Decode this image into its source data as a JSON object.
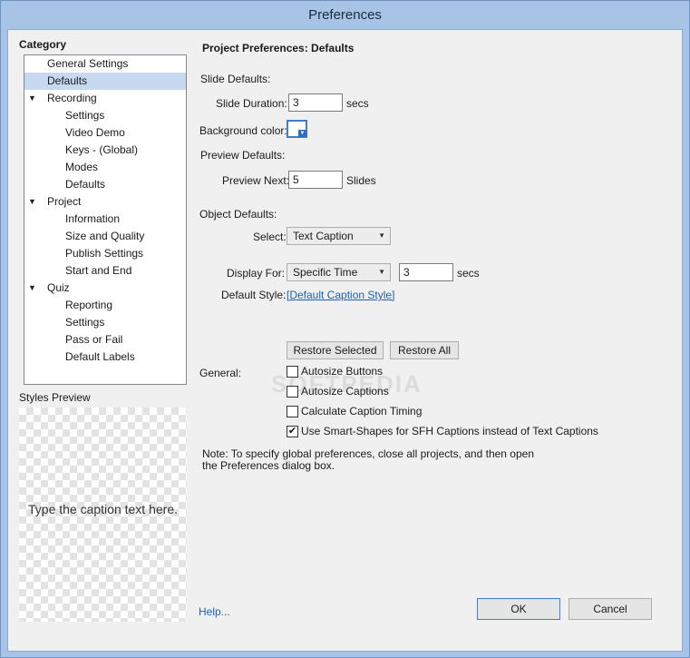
{
  "window": {
    "title": "Preferences"
  },
  "category": {
    "label": "Category",
    "items": [
      {
        "label": "General Settings",
        "level": 0,
        "expandable": false,
        "selected": false
      },
      {
        "label": "Defaults",
        "level": 0,
        "expandable": false,
        "selected": true
      },
      {
        "label": "Recording",
        "level": 0,
        "expandable": true,
        "selected": false
      },
      {
        "label": "Settings",
        "level": 1,
        "expandable": false,
        "selected": false
      },
      {
        "label": "Video Demo",
        "level": 1,
        "expandable": false,
        "selected": false
      },
      {
        "label": "Keys - (Global)",
        "level": 1,
        "expandable": false,
        "selected": false
      },
      {
        "label": "Modes",
        "level": 1,
        "expandable": false,
        "selected": false
      },
      {
        "label": "Defaults",
        "level": 1,
        "expandable": false,
        "selected": false
      },
      {
        "label": "Project",
        "level": 0,
        "expandable": true,
        "selected": false
      },
      {
        "label": "Information",
        "level": 1,
        "expandable": false,
        "selected": false
      },
      {
        "label": "Size and Quality",
        "level": 1,
        "expandable": false,
        "selected": false
      },
      {
        "label": "Publish Settings",
        "level": 1,
        "expandable": false,
        "selected": false
      },
      {
        "label": "Start and End",
        "level": 1,
        "expandable": false,
        "selected": false
      },
      {
        "label": "Quiz",
        "level": 0,
        "expandable": true,
        "selected": false
      },
      {
        "label": "Reporting",
        "level": 1,
        "expandable": false,
        "selected": false
      },
      {
        "label": "Settings",
        "level": 1,
        "expandable": false,
        "selected": false
      },
      {
        "label": "Pass or Fail",
        "level": 1,
        "expandable": false,
        "selected": false
      },
      {
        "label": "Default Labels",
        "level": 1,
        "expandable": false,
        "selected": false
      }
    ]
  },
  "styles_preview": {
    "label": "Styles Preview",
    "caption_text": "Type the caption text here."
  },
  "panel": {
    "heading": "Project Preferences: Defaults",
    "slide_defaults": {
      "label": "Slide Defaults:",
      "duration_label": "Slide Duration:",
      "duration_value": "3",
      "duration_unit": "secs",
      "background_label": "Background color:",
      "background_color": "#ffffff"
    },
    "preview_defaults": {
      "label": "Preview Defaults:",
      "preview_next_label": "Preview Next:",
      "preview_next_value": "5",
      "preview_next_unit": "Slides"
    },
    "object_defaults": {
      "label": "Object Defaults:",
      "select_label": "Select:",
      "select_value": "Text Caption",
      "display_for_label": "Display For:",
      "display_for_value": "Specific Time",
      "display_time_value": "3",
      "display_time_unit": "secs",
      "default_style_label": "Default Style:",
      "default_style_value": "[Default Caption Style]"
    },
    "restore_selected_label": "Restore Selected",
    "restore_all_label": "Restore All",
    "general": {
      "label": "General:",
      "options": [
        {
          "label": "Autosize Buttons",
          "checked": false
        },
        {
          "label": "Autosize Captions",
          "checked": false
        },
        {
          "label": "Calculate Caption Timing",
          "checked": false
        },
        {
          "label": "Use Smart-Shapes for SFH Captions instead of Text Captions",
          "checked": true
        }
      ]
    },
    "note_line1": "Note: To specify global preferences, close all projects, and then open",
    "note_line2": "the Preferences dialog box."
  },
  "footer": {
    "help_label": "Help...",
    "ok_label": "OK",
    "cancel_label": "Cancel"
  },
  "watermark": "SOFTPEDIA",
  "colors": {
    "titlebar": "#a7c4e7",
    "selection": "#c7d9f1",
    "link": "#1f5fb3",
    "accent": "#3c7fd0"
  }
}
